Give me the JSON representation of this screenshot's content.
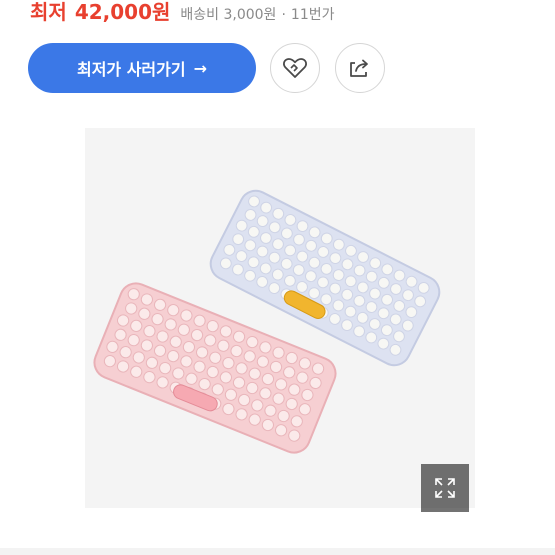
{
  "price": {
    "prefix": "최저",
    "value": "42,000원"
  },
  "shipping": "배송비 3,000원",
  "separator": "·",
  "seller": "11번가",
  "buy_button": {
    "label": "최저가 사러가기",
    "arrow": "→"
  },
  "icons": {
    "wishlist": "heart-icon",
    "share": "share-icon",
    "zoom": "expand-icon"
  },
  "colors": {
    "price": "#e8402f",
    "button": "#3b78e7",
    "muted": "#8a8a8a"
  }
}
